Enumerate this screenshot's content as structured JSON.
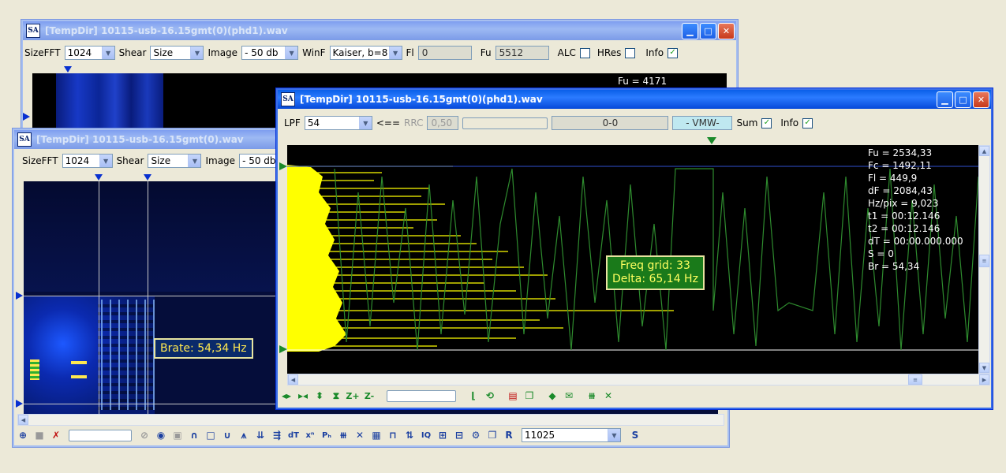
{
  "colors": {
    "accent": "#0a5fe8",
    "signal_green": "#2e8b2e",
    "signal_yellow": "#ffff00",
    "tooltip_green": "#1a7a1a",
    "tooltip_blue": "#0a2a6a"
  },
  "win1": {
    "title": "[TempDir] 10115-usb-16.15gmt(0)(phd1).wav",
    "toolbar": {
      "sizefft_label": "SizeFFT",
      "sizefft_value": "1024",
      "shear_label": "Shear",
      "shear_value": "Size",
      "image_label": "Image",
      "image_value": "- 50 db",
      "winf_label": "WinF",
      "winf_value": "Kaiser, b=8",
      "fl_label": "Fl",
      "fl_value": "0",
      "fu_label": "Fu",
      "fu_value": "5512",
      "alc_label": "ALC",
      "hres_label": "HRes",
      "info_label": "Info"
    },
    "readout": "Fu = 4171"
  },
  "win2": {
    "title": "[TempDir] 10115-usb-16.15gmt(0).wav",
    "toolbar": {
      "sizefft_label": "SizeFFT",
      "sizefft_value": "1024",
      "shear_label": "Shear",
      "shear_value": "Size",
      "image_label": "Image",
      "image_value": "- 50 db"
    },
    "tooltip": "Brate: 54,34 Hz",
    "samplerate_value": "11025",
    "icons": [
      "zoom-icon",
      "stop-icon",
      "delete-icon",
      "slider",
      "disabled-icon",
      "speaker-icon",
      "square-icon",
      "arch-icon",
      "box-icon",
      "valley-icon",
      "peak-icon",
      "double-arrow-icon",
      "triple-arrow-icon",
      "dt-icon",
      "xn-icon",
      "ph-icon",
      "comb-icon",
      "cross-icon",
      "grid-icon",
      "wave-icon",
      "updown-icon",
      "iq-icon",
      "pattern1-icon",
      "pattern2-icon",
      "gear-icon",
      "copy-icon",
      "r-icon"
    ]
  },
  "win3": {
    "title": "[TempDir] 10115-usb-16.15gmt(0)(phd1).wav",
    "toolbar": {
      "lpf_label": "LPF",
      "lpf_value": "54",
      "arrow_label": "<==",
      "rrc_label": "RRC",
      "rrc_value": "0,50",
      "range_value": "0-0",
      "vmw_label": "- VMW-",
      "sum_label": "Sum",
      "info_label": "Info"
    },
    "readout": [
      "Fu = 2534,33",
      "Fc = 1492,11",
      "Fl = 449,9",
      "dF = 2084,43",
      "Hz/pix = 9,023",
      "t1 = 00:12.146",
      "t2 = 00:12.146",
      "dT = 00:00.000.000",
      "S = 0",
      "Br = 54,34"
    ],
    "tooltip_line1": "Freq grid: 33",
    "tooltip_line2": "Delta: 65,14 Hz"
  }
}
